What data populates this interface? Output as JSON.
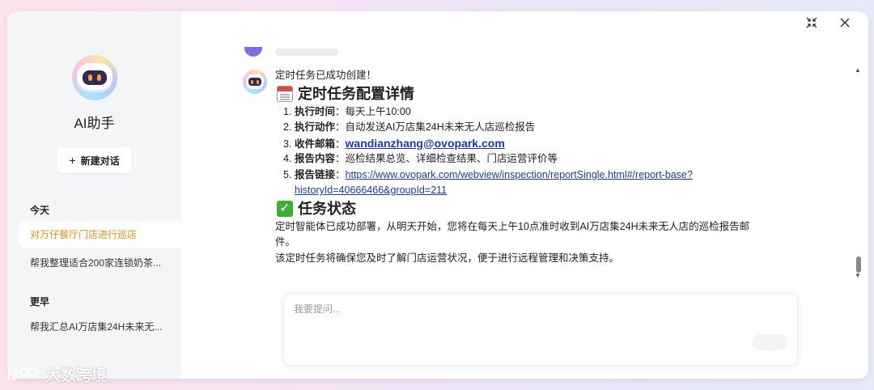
{
  "sidebar": {
    "app_title": "AI助手",
    "new_chat_label": "新建对话",
    "today_label": "今天",
    "earlier_label": "更早",
    "today_items": [
      {
        "label": "对万仔餐厅门店进行巡店",
        "active": true
      },
      {
        "label": "帮我整理适合200家连锁奶茶..."
      }
    ],
    "earlier_items": [
      {
        "label": "帮我汇总AI万店集24H未来无..."
      }
    ]
  },
  "window_controls": {
    "minimize_icon": "collapse-icon",
    "close_icon": "close-icon"
  },
  "message": {
    "intro": "定时任务已成功创建！",
    "config_heading": "定时任务配置详情",
    "config_items": [
      {
        "num": "1.",
        "label": "执行时间",
        "sep": "：",
        "value": "每天上午10:00"
      },
      {
        "num": "2.",
        "label": "执行动作",
        "sep": "：",
        "value": "自动发送AI万店集24H未来无人店巡检报告"
      },
      {
        "num": "3.",
        "label": "收件邮箱",
        "sep": "：",
        "value": "wandianzhang@ovopark.com"
      },
      {
        "num": "4.",
        "label": "报告内容",
        "sep": "：",
        "value": "巡检结果总览、详细检查结果、门店运营评价等"
      },
      {
        "num": "5.",
        "label": "报告链接",
        "sep": "：",
        "value": "https://www.ovopark.com/webview/inspection/reportSingle.html#/report-base?",
        "value_cont": "historyId=40666466&groupId=211"
      }
    ],
    "status_heading": "任务状态",
    "status_text_1": "定时智能体已成功部署，从明天开始，您将在每天上午10点准时收到AI万店集24H未来无人店的巡检报告邮",
    "status_text_2": "件。",
    "status_text_3": "该定时任务将确保您及时了解门店运营状况，便于进行远程管理和决策支持。"
  },
  "input": {
    "placeholder": "我要提问..."
  },
  "watermark": {
    "text": "大数跨境"
  }
}
